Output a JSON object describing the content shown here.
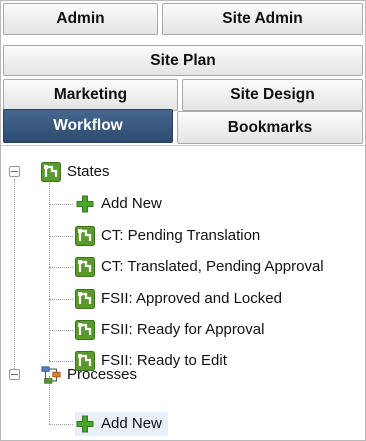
{
  "tabs": {
    "admin": "Admin",
    "site_admin": "Site Admin",
    "site_plan": "Site Plan",
    "marketing": "Marketing",
    "site_design": "Site Design",
    "workflow": "Workflow",
    "bookmarks": "Bookmarks",
    "active": "Workflow"
  },
  "tree": {
    "states": {
      "label": "States",
      "expanded": true,
      "icon": "state-icon",
      "children": [
        {
          "label": "Add New",
          "icon": "add-icon"
        },
        {
          "label": "CT: Pending Translation",
          "icon": "state-icon"
        },
        {
          "label": "CT: Translated, Pending Approval",
          "icon": "state-icon"
        },
        {
          "label": "FSII: Approved and Locked",
          "icon": "state-icon"
        },
        {
          "label": "FSII: Ready for Approval",
          "icon": "state-icon"
        },
        {
          "label": "FSII: Ready to Edit",
          "icon": "state-icon"
        }
      ]
    },
    "processes": {
      "label": "Processes",
      "expanded": true,
      "icon": "process-icon",
      "children": [
        {
          "label": "Add New",
          "icon": "add-icon",
          "highlighted": true
        }
      ]
    }
  },
  "colors": {
    "active_tab": "#35557b",
    "state_icon_green": "#5a9a2c",
    "add_plus_green": "#4aa52b",
    "highlight": "#e8eff8"
  }
}
